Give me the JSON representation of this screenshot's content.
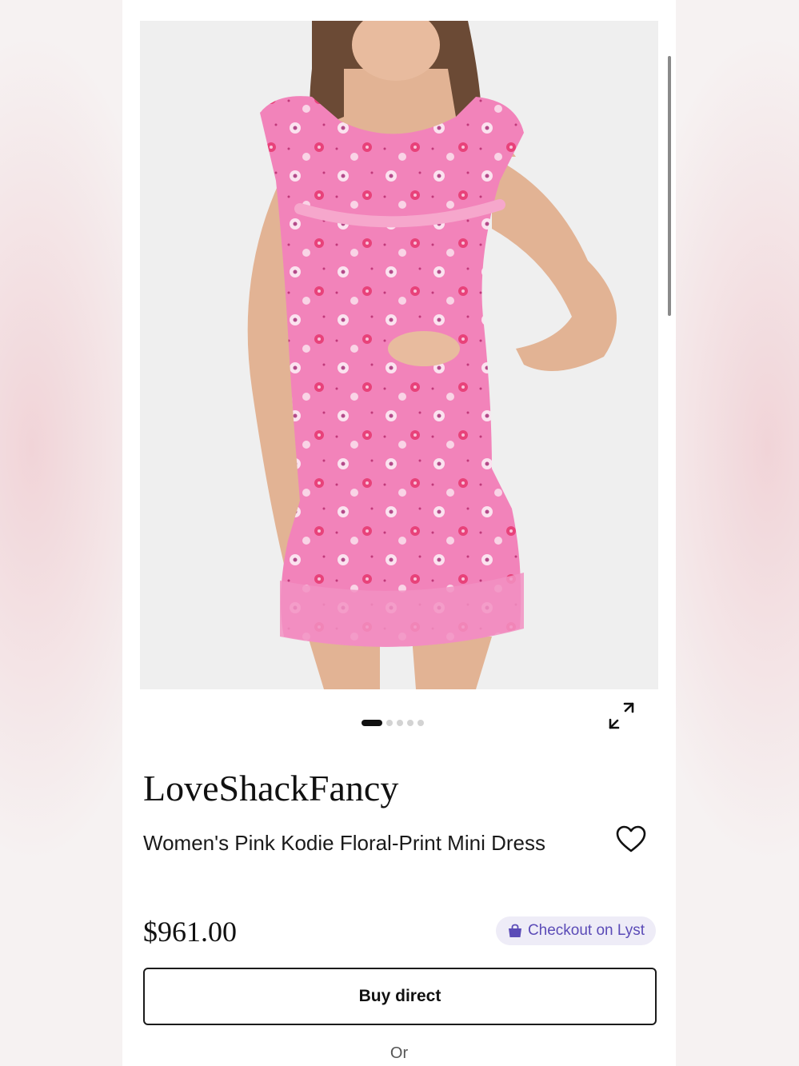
{
  "product": {
    "brand": "LoveShackFancy",
    "title": "Women's Pink Kodie Floral-Print Mini Dress",
    "price": "$961.00",
    "image_count": 5,
    "active_image_index": 0
  },
  "actions": {
    "checkout_label": "Checkout on Lyst",
    "buy_label": "Buy direct",
    "or_label": "Or"
  },
  "icons": {
    "expand": "expand-icon",
    "favorite": "heart-icon",
    "checkout": "shopping-bag-icon"
  },
  "colors": {
    "accent": "#5b4bb7",
    "accent_bg": "#eeecf7",
    "dress_pink": "#f07fb6"
  }
}
